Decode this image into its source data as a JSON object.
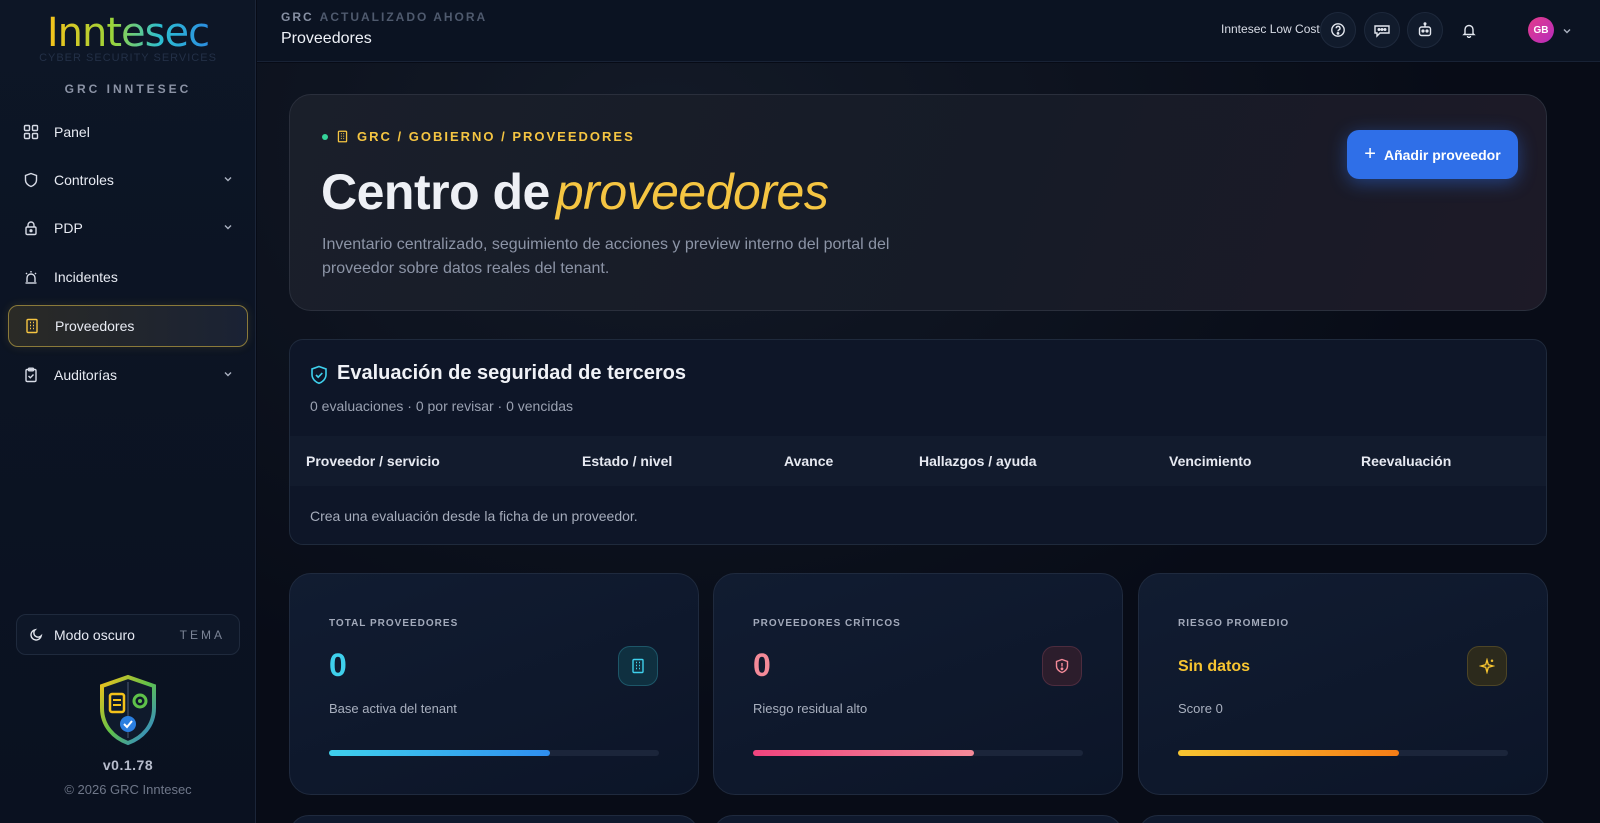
{
  "sidebar": {
    "logo": "Inntesec",
    "logo_sub": "CYBER SECURITY SERVICES",
    "brand": "GRC INNTESEC",
    "items": [
      {
        "label": "Panel"
      },
      {
        "label": "Controles"
      },
      {
        "label": "PDP"
      },
      {
        "label": "Incidentes"
      },
      {
        "label": "Proveedores"
      },
      {
        "label": "Auditorías"
      }
    ],
    "theme_label": "Modo oscuro",
    "theme_tag": "TEMA",
    "version": "v0.1.78",
    "copyright": "© 2026 GRC Inntesec"
  },
  "header": {
    "crumb": "GRC",
    "updated": "ACTUALIZADO AHORA",
    "title": "Proveedores",
    "org": "Inntesec Low Cost",
    "avatar": "GB",
    "icons": [
      "help-icon",
      "feedback-icon",
      "bot-icon",
      "bell-icon"
    ]
  },
  "hero": {
    "crumb": "GRC / GOBIERNO / PROVEEDORES",
    "title_main": "Centro de",
    "title_accent": "proveedores",
    "description": "Inventario centralizado, seguimiento de acciones y preview interno del portal del proveedor sobre datos reales del tenant.",
    "add_button": "Añadir proveedor"
  },
  "evaluation": {
    "title": "Evaluación de seguridad de terceros",
    "summary": "0 evaluaciones · 0 por revisar · 0 vencidas",
    "columns": [
      "Proveedor / servicio",
      "Estado / nivel",
      "Avance",
      "Hallazgos / ayuda",
      "Vencimiento",
      "Reevaluación"
    ],
    "empty": "Crea una evaluación desde la ficha de un proveedor."
  },
  "cards": [
    {
      "label": "TOTAL PROVEEDORES",
      "value": "0",
      "note": "Base activa del tenant",
      "color": "#3fd0ec",
      "progress": 0.67
    },
    {
      "label": "PROVEEDORES CRÍTICOS",
      "value": "0",
      "note": "Riesgo residual alto",
      "color": "#f48a98",
      "progress": 0.67
    },
    {
      "label": "RIESGO PROMEDIO",
      "value": "Sin datos",
      "note": "Score 0",
      "color": "#f7c531",
      "progress": 0.67
    }
  ],
  "colors": {
    "accent_gold": "#f5c542",
    "primary_blue": "#2f6fe8",
    "cyan": "#3fd0ec",
    "pink": "#f48a98"
  }
}
